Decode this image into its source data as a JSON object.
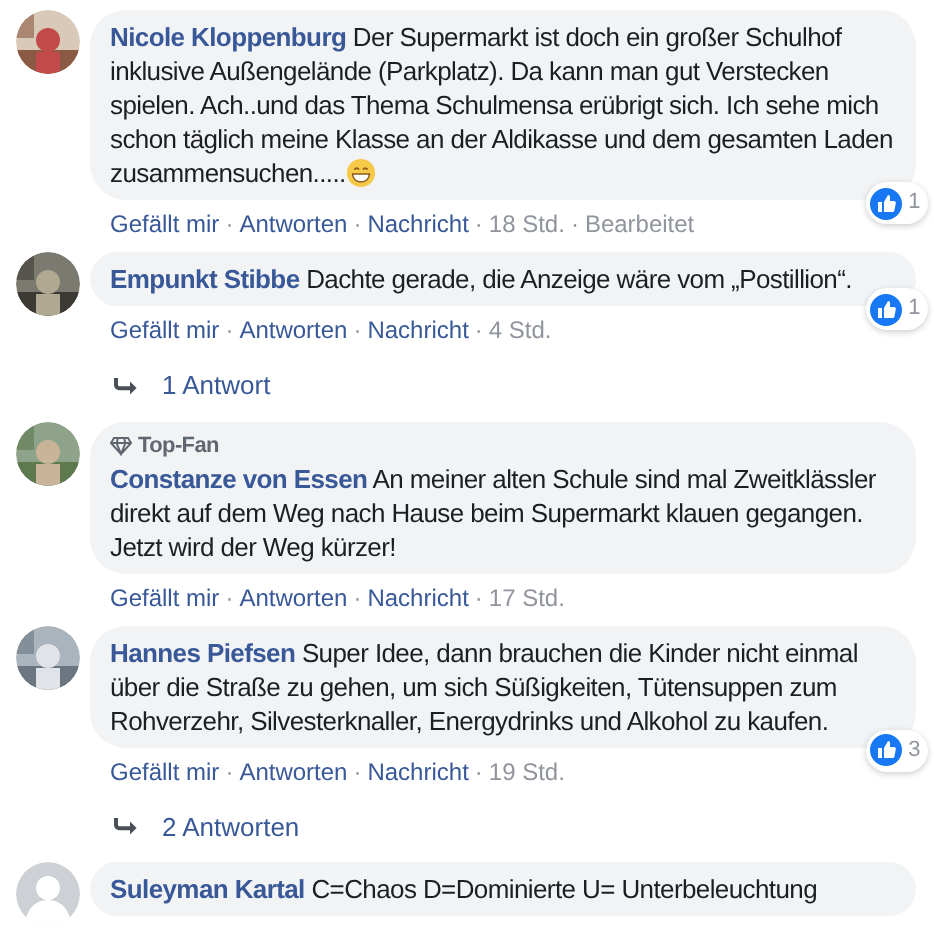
{
  "separator": "·",
  "comments": [
    {
      "default_avatar": false,
      "name": "Nicole Kloppenburg",
      "text": "Der Supermarkt ist doch ein großer Schulhof inklusive Außengelände (Parkplatz). Da kann man gut Verstecken spielen. Ach..und das Thema Schulmensa erübrigt sich. Ich sehe mich schon täglich meine Klasse an der Aldikasse und dem gesamten Laden zusammensuchen.....",
      "trailing_emoji": true,
      "reactions": "1",
      "actions": [
        "Gefällt mir",
        "Antworten",
        "Nachricht"
      ],
      "time": "18 Std.",
      "edited": "Bearbeitet"
    },
    {
      "default_avatar": false,
      "name": "Empunkt Stibbe",
      "text": "Dachte gerade, die Anzeige wäre vom „Postillion“.",
      "reactions": "1",
      "actions": [
        "Gefällt mir",
        "Antworten",
        "Nachricht"
      ],
      "time": "4 Std.",
      "replies": "1 Antwort"
    },
    {
      "default_avatar": false,
      "top_fan": "Top-Fan",
      "name": "Constanze von Essen",
      "text": "An meiner alten Schule sind mal Zweitklässler direkt auf dem Weg nach Hause beim Supermarkt klauen gegangen. Jetzt wird der Weg kürzer!",
      "actions": [
        "Gefällt mir",
        "Antworten",
        "Nachricht"
      ],
      "time": "17 Std."
    },
    {
      "default_avatar": false,
      "name": "Hannes Piefsen",
      "text": "Super Idee, dann brauchen die Kinder nicht einmal über die Straße zu gehen, um sich Süßigkeiten, Tütensuppen zum Rohverzehr, Silvesterknaller, Energydrinks und Alkohol zu kaufen.",
      "reactions": "3",
      "actions": [
        "Gefällt mir",
        "Antworten",
        "Nachricht"
      ],
      "time": "19 Std.",
      "replies": "2 Antworten"
    },
    {
      "default_avatar": true,
      "name": "Suleyman Kartal",
      "text": "C=Chaos D=Dominierte U= Unterbeleuchtung"
    }
  ]
}
